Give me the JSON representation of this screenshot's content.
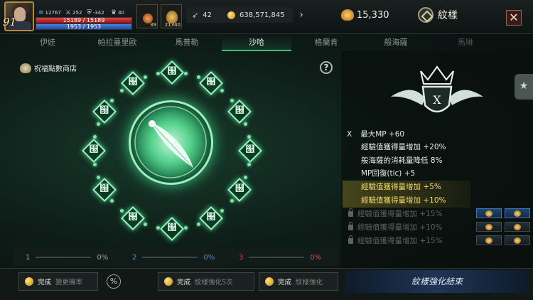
{
  "player": {
    "level": "91",
    "stat_a": "12767",
    "stat_b": "252",
    "stat_c": "-342",
    "stat_d": "40",
    "hp_text": "15189 / 15189",
    "hp_fraction": 1.0,
    "mp_text": "1953 / 1953",
    "mp_fraction": 1.0
  },
  "hud": {
    "item1_count": "39",
    "item2_count": "21340",
    "feather_count": "42",
    "gold": "638,571,845",
    "points": "15,330",
    "title": "紋樣",
    "close": "✕",
    "arrow": "›"
  },
  "tabs": [
    "伊娃",
    "帕拉蔓里歐",
    "馬普勒",
    "沙哈",
    "格蘭肯",
    "般海薩",
    "馬琳"
  ],
  "active_tab": 3,
  "left": {
    "shop_label": "祝福點數商店",
    "help": "?",
    "progress": [
      {
        "num": "1",
        "pct": "0%",
        "num_color": "#9aa4a0",
        "pct_color": "#9aa4a0"
      },
      {
        "num": "2",
        "pct": "0%",
        "num_color": "#4a8fe0",
        "pct_color": "#4a8fe0"
      },
      {
        "num": "3",
        "pct": "0%",
        "num_color": "#e04545",
        "pct_color": "#e04545"
      }
    ]
  },
  "right": {
    "emblem_letter": "X",
    "grade": "X",
    "stats": [
      "最大MP +60",
      "經驗值獲得量增加 +20%",
      "般海薩的消耗量降低 8%",
      "MP回復(tic) +5",
      "經驗值獲得量增加 +5%",
      "經驗值獲得量增加 +10%",
      "經驗值獲得量增加 +15%",
      "經驗值獲得量增加 +10%",
      "經驗值獲得量增加 +15%"
    ],
    "side_tab_icon": "★"
  },
  "bottom": {
    "btn1_done": "完成",
    "btn1_label": "變更機率",
    "pct_icon": "%",
    "btn2_done": "完成",
    "btn2_label": "紋樣強化5次",
    "btn3_done": "完成",
    "btn3_label": "紋樣強化",
    "end_label": "紋樣強化結束"
  },
  "colors": {
    "accent_green": "#3cc07a",
    "highlight_gold": "#f3d96a"
  }
}
